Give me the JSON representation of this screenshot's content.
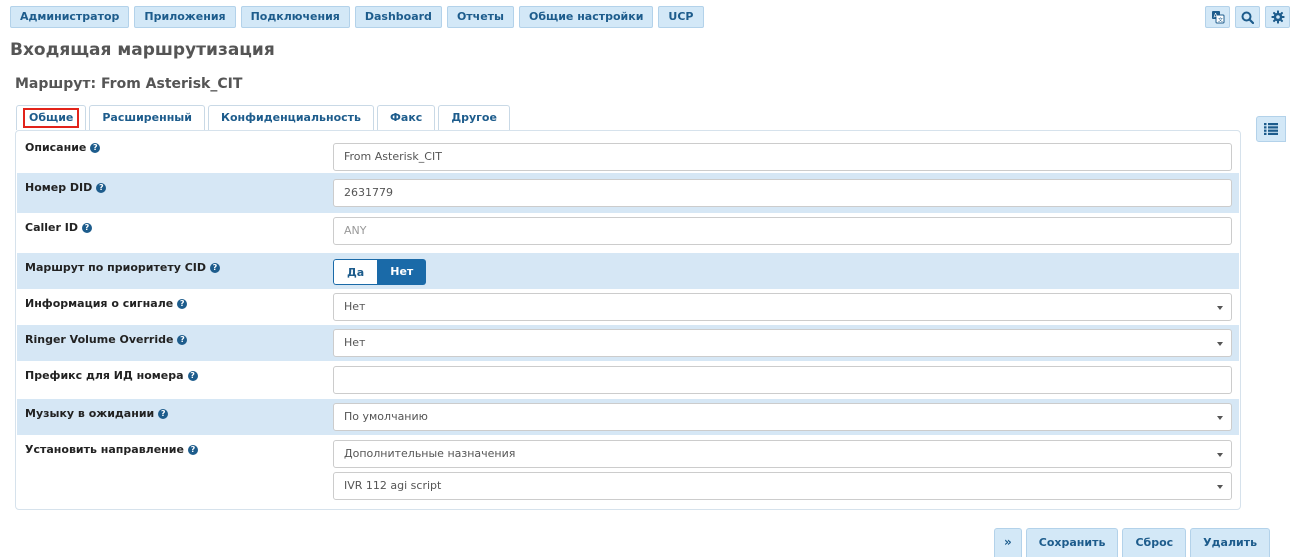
{
  "nav": {
    "items": [
      "Администратор",
      "Приложения",
      "Подключения",
      "Dashboard",
      "Отчеты",
      "Общие настройки",
      "UCP"
    ],
    "icons": [
      "translate-icon",
      "search-icon",
      "gear-icon"
    ]
  },
  "page": {
    "title": "Входящая маршрутизация",
    "route_title": "Маршрут: From Asterisk_CIT"
  },
  "tabs": [
    "Общие",
    "Расширенный",
    "Конфиденциальность",
    "Факс",
    "Другое"
  ],
  "form": {
    "description": {
      "label": "Описание",
      "value": "From Asterisk_CIT"
    },
    "did": {
      "label": "Номер DID",
      "value": "2631779"
    },
    "callerid": {
      "label": "Caller ID",
      "placeholder": "ANY"
    },
    "cid_priority": {
      "label": "Маршрут по приоритету CID",
      "yes": "Да",
      "no": "Нет"
    },
    "alertinfo": {
      "label": "Информация о сигнале",
      "value": "Нет"
    },
    "ringer": {
      "label": "Ringer Volume Override",
      "value": "Нет"
    },
    "prefix": {
      "label": "Префикс для ИД номера",
      "value": ""
    },
    "moh": {
      "label": "Музыку в ожидании",
      "value": "По умолчанию"
    },
    "destination": {
      "label": "Установить направление",
      "category": "Дополнительные назначения",
      "target": "IVR 112 agi script"
    }
  },
  "actions": {
    "expand": "»",
    "save": "Сохранить",
    "reset": "Сброс",
    "delete": "Удалить"
  },
  "colors": {
    "accent": "#1a6aa8",
    "row_alt": "#d6e7f5",
    "nav_bg": "#d3e8f7",
    "highlight": "#e2231a"
  }
}
